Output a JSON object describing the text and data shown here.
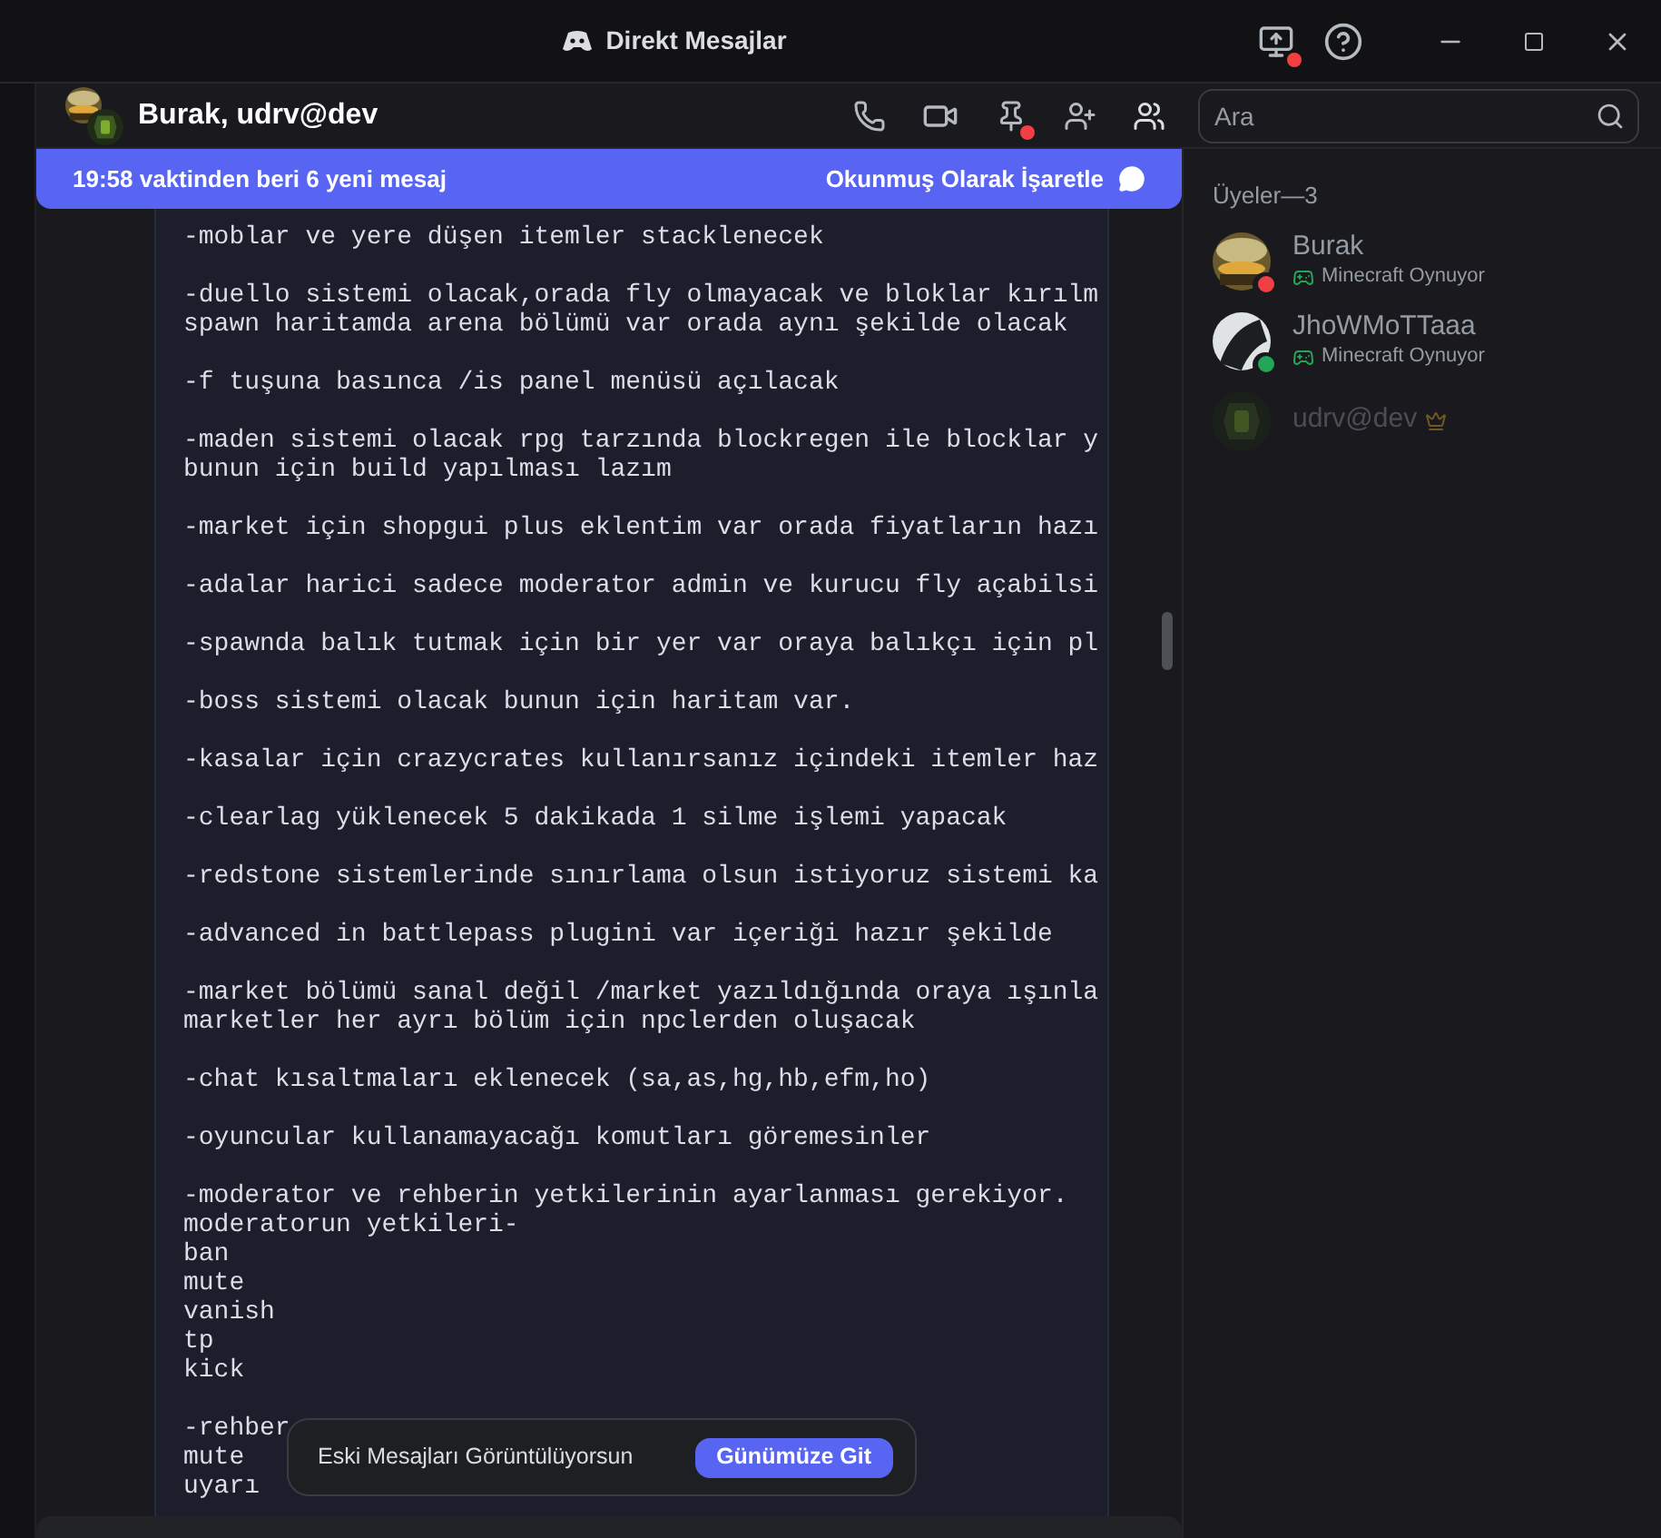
{
  "window": {
    "title": "Direkt Mesajlar"
  },
  "header": {
    "title": "Burak, udrv@dev",
    "search": {
      "placeholder": "Ara"
    }
  },
  "banner": {
    "text": "19:58 vaktinden beri 6 yeni mesaj",
    "action": "Okunmuş Olarak İşaretle"
  },
  "code_block": [
    [
      "-moblar ve yere düşen itemler stacklenecek"
    ],
    [
      "-duello sistemi olacak,orada fly olmayacak ve bloklar kırılm",
      "spawn haritamda arena bölümü var orada aynı şekilde olacak"
    ],
    [
      "-f tuşuna basınca /is panel menüsü açılacak"
    ],
    [
      "-maden sistemi olacak rpg tarzında blockregen ile blocklar y",
      "bunun için build yapılması lazım"
    ],
    [
      "-market için shopgui plus eklentim var orada fiyatların hazı"
    ],
    [
      "-adalar harici sadece moderator admin ve kurucu fly açabilsi"
    ],
    [
      "-spawnda balık tutmak için bir yer var oraya balıkçı için pl"
    ],
    [
      "-boss sistemi olacak bunun için haritam var."
    ],
    [
      "-kasalar için crazycrates kullanırsanız içindeki itemler haz"
    ],
    [
      "-clearlag yüklenecek 5 dakikada 1 silme işlemi yapacak"
    ],
    [
      "-redstone sistemlerinde sınırlama olsun istiyoruz sistemi ka"
    ],
    [
      "-advanced in battlepass plugini var içeriği hazır şekilde"
    ],
    [
      "-market bölümü sanal değil /market yazıldığında oraya ışınla",
      "marketler her ayrı bölüm için npclerden oluşacak"
    ],
    [
      "-chat kısaltmaları eklenecek (sa,as,hg,hb,efm,ho)"
    ],
    [
      "-oyuncular kullanamayacağı komutları göremesinler"
    ],
    [
      "-moderator ve rehberin yetkilerinin ayarlanması gerekiyor.",
      "moderatorun yetkileri-",
      "ban",
      "mute",
      "vanish",
      "tp",
      "kick"
    ],
    [
      "-rehber",
      "mute",
      "uyarı"
    ]
  ],
  "toast": {
    "text": "Eski Mesajları Görüntülüyorsun",
    "button": "Günümüze Git"
  },
  "members": {
    "heading": "Üyeler—3",
    "items": [
      {
        "name": "Burak",
        "activity": "Minecraft Oynuyor",
        "color": "#f23f43",
        "offline": false,
        "owner": false
      },
      {
        "name": "JhoWMoTTaaa",
        "activity": "Minecraft Oynuyor",
        "color": "#23a55a",
        "offline": false,
        "owner": false
      },
      {
        "name": "udrv@dev",
        "offline": true,
        "owner": true
      }
    ]
  }
}
